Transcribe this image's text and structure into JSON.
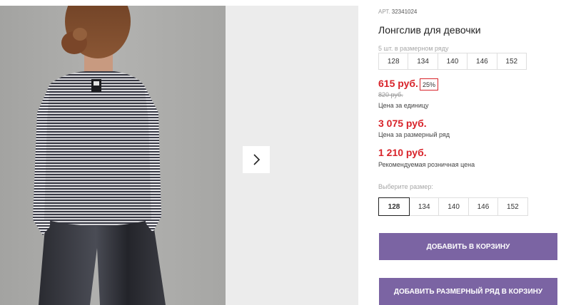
{
  "gallery": {
    "photo_alt": "girl in striped long-sleeve top and black trousers, back view",
    "next_icon": "chevron-right-icon"
  },
  "product": {
    "article_label": "АРТ.",
    "article_value": "32341024",
    "title": "Лонгслив для девочки",
    "pack_label": "5 шт. в размерном ряду",
    "pack_sizes": [
      "128",
      "134",
      "140",
      "146",
      "152"
    ]
  },
  "pricing": {
    "unit_price": "615 руб.",
    "discount": "25%",
    "old_price": "820 руб.",
    "unit_note": "Цена за единицу",
    "pack_price": "3 075 руб.",
    "pack_note": "Цена за размерный ряд",
    "retail_price": "1 210 руб.",
    "retail_note": "Рекомендуемая розничная цена",
    "accent_color": "#d8232a"
  },
  "size_picker": {
    "label": "Выберите размер:",
    "sizes": [
      "128",
      "134",
      "140",
      "146",
      "152"
    ],
    "selected": "128"
  },
  "actions": {
    "add_to_cart": "ДОБАВИТЬ В КОРЗИНУ",
    "add_pack_to_cart": "ДОБАВИТЬ РАЗМЕРНЫЙ РЯД В КОРЗИНУ",
    "button_color": "#7b64a3"
  }
}
